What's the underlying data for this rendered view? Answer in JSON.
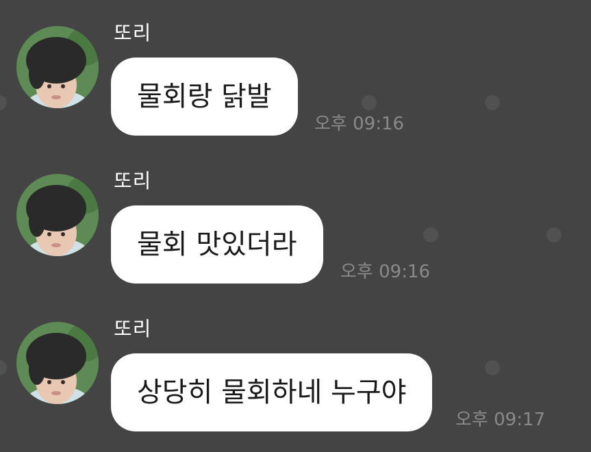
{
  "messages": [
    {
      "sender": "또리",
      "text": "물회랑 닭발",
      "time": "오후 09:16"
    },
    {
      "sender": "또리",
      "text": "물회 맛있더라",
      "time": "오후 09:16"
    },
    {
      "sender": "또리",
      "text": "상당히 물회하네 누구야",
      "time": "오후 09:17"
    }
  ],
  "colors": {
    "background": "#444444",
    "bubble": "#ffffff",
    "sender_text": "#ffffff",
    "time_text": "#8a8a8a",
    "decor_dot": "#515151"
  }
}
